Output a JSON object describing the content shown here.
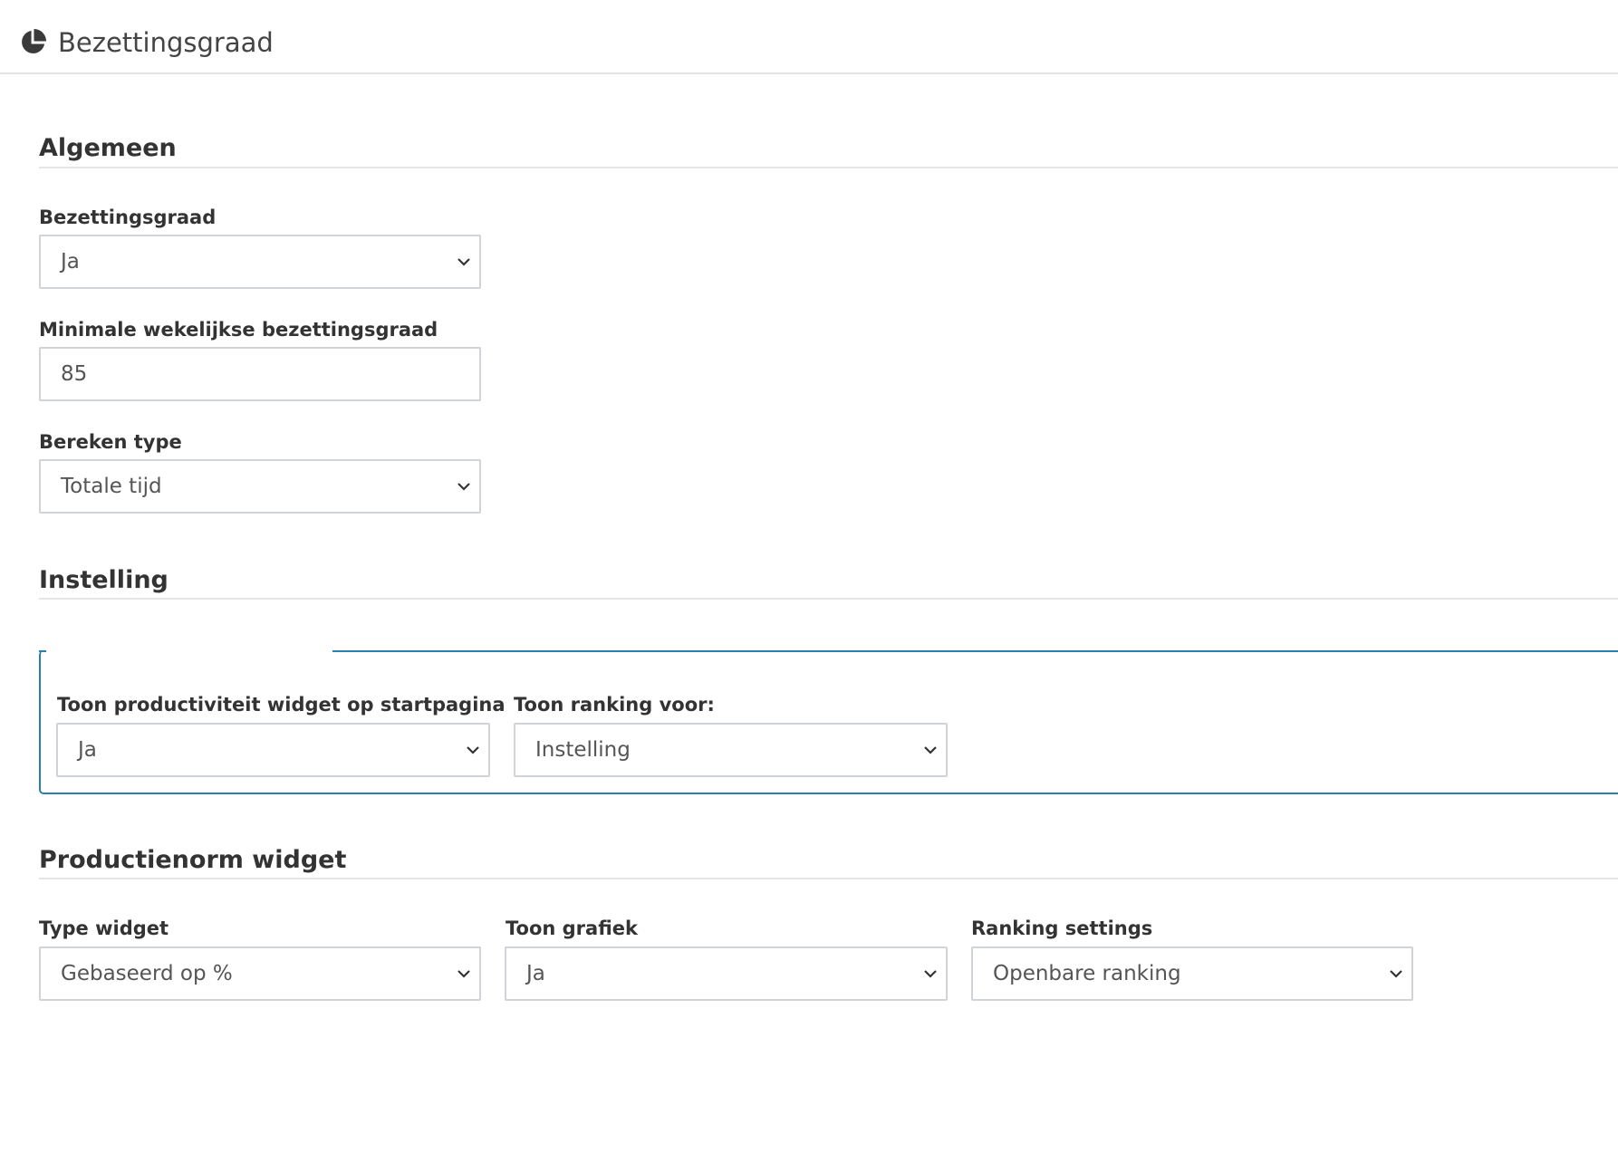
{
  "header": {
    "title": "Bezettingsgraad",
    "icon": "pie-chart-icon"
  },
  "sections": {
    "algemeen": {
      "title": "Algemeen",
      "fields": {
        "bezettingsgraad": {
          "label": "Bezettingsgraad",
          "value": "Ja"
        },
        "minimale": {
          "label": "Minimale wekelijkse bezettingsgraad",
          "value": "85"
        },
        "bereken_type": {
          "label": "Bereken type",
          "value": "Totale tijd"
        }
      }
    },
    "instelling": {
      "title": "Instelling",
      "fields": {
        "toon_productiviteit": {
          "label": "Toon productiviteit widget op startpagina",
          "value": "Ja"
        },
        "toon_ranking": {
          "label": "Toon ranking voor:",
          "value": "Instelling"
        }
      }
    },
    "productienorm": {
      "title": "Productienorm widget",
      "fields": {
        "type_widget": {
          "label": "Type widget",
          "value": "Gebaseerd op %"
        },
        "toon_grafiek": {
          "label": "Toon grafiek",
          "value": "Ja"
        },
        "ranking_settings": {
          "label": "Ranking settings",
          "value": "Openbare ranking"
        }
      }
    }
  },
  "colors": {
    "fieldset_border": "#2a7fb0",
    "input_border": "#d0d4d9",
    "divider": "#e5e5e5"
  }
}
